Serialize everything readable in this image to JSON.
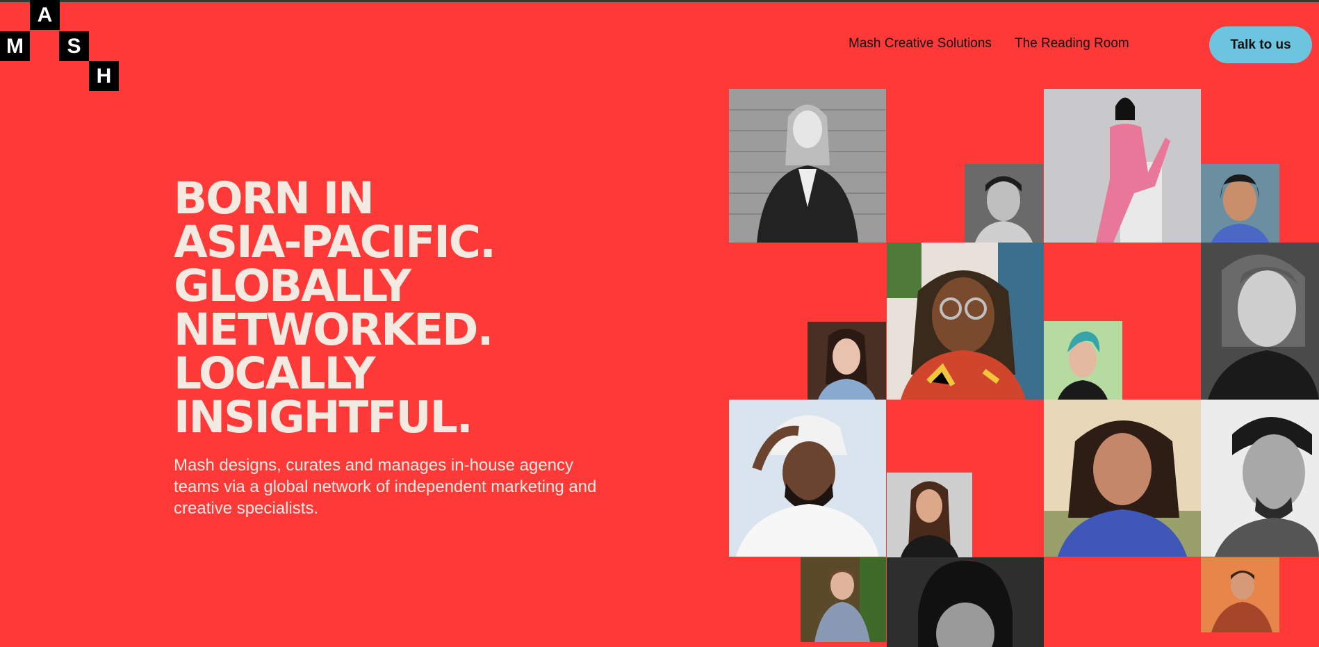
{
  "logo": {
    "letters": [
      "A",
      "M",
      "S",
      "H"
    ]
  },
  "nav": {
    "links": [
      "Mash Creative Solutions",
      "The Reading Room"
    ],
    "cta": "Talk to us"
  },
  "hero": {
    "headline_lines": [
      "BORN IN",
      "ASIA-PACIFIC.",
      "GLOBALLY",
      "NETWORKED.",
      "LOCALLY",
      "INSIGHTFUL."
    ],
    "subtext": "Mash designs, curates and manages in-house agency teams via a global network of independent marketing and creative specialists."
  },
  "colors": {
    "background": "#ff3838",
    "headline": "#f3ebe1",
    "cta": "#6cc4df",
    "logo": "#000000"
  }
}
